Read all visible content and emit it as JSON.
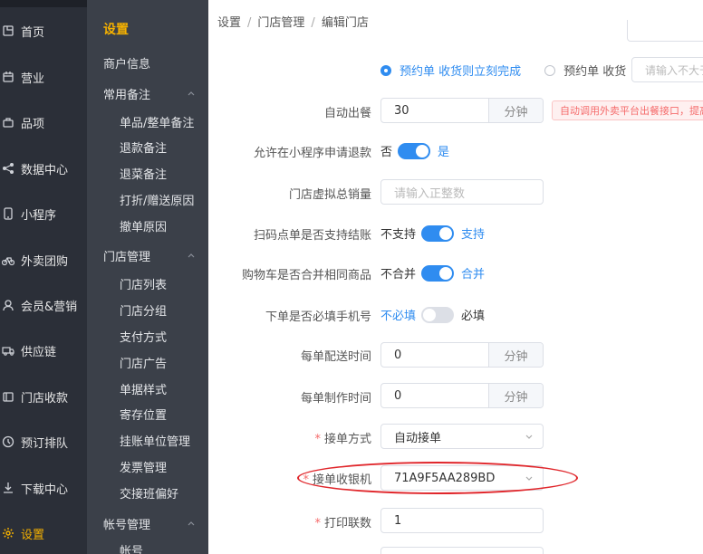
{
  "nav1": {
    "items": [
      {
        "label": "首页",
        "icon": "home-icon"
      },
      {
        "label": "营业",
        "icon": "calendar-icon"
      },
      {
        "label": "品项",
        "icon": "bag-icon"
      },
      {
        "label": "数据中心",
        "icon": "share-icon"
      },
      {
        "label": "小程序",
        "icon": "phone-icon"
      },
      {
        "label": "外卖团购",
        "icon": "bike-icon"
      },
      {
        "label": "会员&营销",
        "icon": "user-icon"
      },
      {
        "label": "供应链",
        "icon": "truck-icon"
      },
      {
        "label": "门店收款",
        "icon": "wallet-icon"
      },
      {
        "label": "预订排队",
        "icon": "clock-icon"
      },
      {
        "label": "下载中心",
        "icon": "download-icon"
      },
      {
        "label": "设置",
        "icon": "gear-icon"
      }
    ],
    "active_index": 11,
    "active_color": "#f5b100"
  },
  "nav2": {
    "title": "设置",
    "items": [
      {
        "label": "商户信息",
        "type": "group"
      },
      {
        "label": "常用备注",
        "type": "group",
        "expanded": true
      },
      {
        "label": "单品/整单备注",
        "type": "leaf"
      },
      {
        "label": "退款备注",
        "type": "leaf"
      },
      {
        "label": "退菜备注",
        "type": "leaf"
      },
      {
        "label": "打折/赠送原因",
        "type": "leaf"
      },
      {
        "label": "撤单原因",
        "type": "leaf"
      },
      {
        "label": "门店管理",
        "type": "group",
        "expanded": true
      },
      {
        "label": "门店列表",
        "type": "leaf"
      },
      {
        "label": "门店分组",
        "type": "leaf"
      },
      {
        "label": "支付方式",
        "type": "leaf"
      },
      {
        "label": "门店广告",
        "type": "leaf"
      },
      {
        "label": "单据样式",
        "type": "leaf"
      },
      {
        "label": "寄存位置",
        "type": "leaf"
      },
      {
        "label": "挂账单位管理",
        "type": "leaf"
      },
      {
        "label": "发票管理",
        "type": "leaf"
      },
      {
        "label": "交接班偏好",
        "type": "leaf"
      },
      {
        "label": "帐号管理",
        "type": "group",
        "expanded": true
      },
      {
        "label": "帐号",
        "type": "leaf"
      }
    ]
  },
  "breadcrumb": [
    "设置",
    "门店管理",
    "编辑门店"
  ],
  "form": {
    "preorder": {
      "option1": "预约单 收货则立刻完成",
      "option2": "预约单 收货",
      "placeholder": "请输入不大于"
    },
    "auto_serve": {
      "label": "自动出餐",
      "value": "30",
      "unit": "分钟",
      "alert": "自动调用外卖平台出餐接口，提高"
    },
    "mini_refund": {
      "label": "允许在小程序申请退款",
      "off": "否",
      "on": "是",
      "state": "on"
    },
    "virtual_sales": {
      "label": "门店虚拟总销量",
      "placeholder": "请输入正整数"
    },
    "scan_checkout": {
      "label": "扫码点单是否支持结账",
      "off": "不支持",
      "on": "支持",
      "state": "on"
    },
    "cart_merge": {
      "label": "购物车是否合并相同商品",
      "off": "不合并",
      "on": "合并",
      "state": "on"
    },
    "phone_required": {
      "label": "下单是否必填手机号",
      "off": "不必填",
      "on": "必填",
      "state": "off"
    },
    "delivery_time": {
      "label": "每单配送时间",
      "value": "0",
      "unit": "分钟"
    },
    "prep_time": {
      "label": "每单制作时间",
      "value": "0",
      "unit": "分钟"
    },
    "accept_mode": {
      "label": "接单方式",
      "value": "自动接单"
    },
    "accept_cashier": {
      "label": "接单收银机",
      "value": "71A9F5AA289BD"
    },
    "print_copies": {
      "label": "打印联数",
      "value": "1"
    }
  },
  "colors": {
    "accent": "#2f8cf0",
    "annotation": "#e0262b",
    "required": "#f56c6c"
  }
}
